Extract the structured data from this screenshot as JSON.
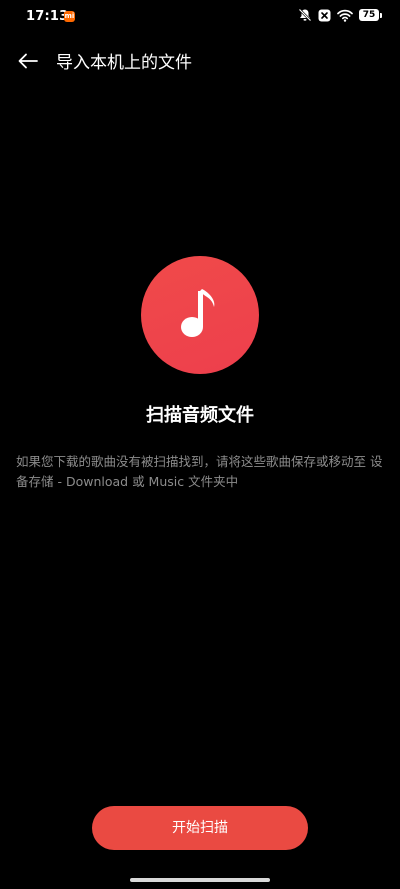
{
  "status_bar": {
    "time": "17:13",
    "mi_badge": "mi",
    "battery_level": "75",
    "icons": [
      "mute-bell-icon",
      "close-box-icon",
      "wifi-icon",
      "battery-icon"
    ]
  },
  "app_bar": {
    "title": "导入本机上的文件",
    "back_icon": "arrow-left-icon"
  },
  "main": {
    "icon": "music-note-icon",
    "heading": "扫描音频文件",
    "hint": "如果您下载的歌曲没有被扫描找到，请将这些歌曲保存或移动至 设备存储 - Download 或 Music 文件夹中"
  },
  "actions": {
    "start_label": "开始扫描"
  },
  "colors": {
    "background": "#000000",
    "accent": "#ea4a42",
    "hint_text": "#8c8c8c"
  }
}
